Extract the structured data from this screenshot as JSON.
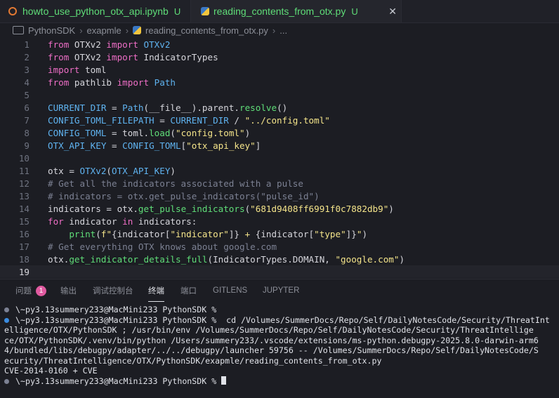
{
  "tabs": [
    {
      "label": "howto_use_python_otx_api.ipynb",
      "status": "U",
      "icon": "jupyter-icon"
    },
    {
      "label": "reading_contents_from_otx.py",
      "status": "U",
      "icon": "python-icon"
    }
  ],
  "breadcrumb": [
    "PythonSDK",
    "exapmle",
    "reading_contents_from_otx.py",
    "..."
  ],
  "editor": {
    "lines": [
      {
        "n": "1"
      },
      {
        "n": "2"
      },
      {
        "n": "3"
      },
      {
        "n": "4"
      },
      {
        "n": "5"
      },
      {
        "n": "6"
      },
      {
        "n": "7"
      },
      {
        "n": "8"
      },
      {
        "n": "9"
      },
      {
        "n": "10"
      },
      {
        "n": "11"
      },
      {
        "n": "12"
      },
      {
        "n": "13"
      },
      {
        "n": "14"
      },
      {
        "n": "15"
      },
      {
        "n": "16"
      },
      {
        "n": "17"
      },
      {
        "n": "18"
      },
      {
        "n": "19"
      }
    ],
    "code": {
      "l1": [
        "from",
        " OTXv2 ",
        "import",
        " OTXv2"
      ],
      "l2": [
        "from",
        " OTXv2 ",
        "import",
        " IndicatorTypes"
      ],
      "l3": [
        "import",
        " toml"
      ],
      "l4": [
        "from",
        " pathlib ",
        "import",
        " Path"
      ],
      "l6": [
        "CURRENT_DIR",
        " = ",
        "Path",
        "(__file__).parent.",
        "resolve",
        "()"
      ],
      "l7": [
        "CONFIG_TOML_FILEPATH",
        " = ",
        "CURRENT_DIR",
        " / ",
        "\"../config.toml\""
      ],
      "l8": [
        "CONFIG_TOML",
        " = toml.",
        "load",
        "(",
        "\"config.toml\"",
        ")"
      ],
      "l9": [
        "OTX_API_KEY",
        " = ",
        "CONFIG_TOML",
        "[",
        "\"otx_api_key\"",
        "]"
      ],
      "l11": [
        "otx = ",
        "OTXv2",
        "(",
        "OTX_API_KEY",
        ")"
      ],
      "l12": "# Get all the indicators associated with a pulse",
      "l13": "# indicators = otx.get_pulse_indicators(\"pulse_id\")",
      "l14": [
        "indicators = otx.",
        "get_pulse_indicators",
        "(",
        "\"681d9408ff6991f0c7882db9\"",
        ")"
      ],
      "l15": [
        "for",
        " indicator ",
        "in",
        " indicators:"
      ],
      "l16": [
        "    ",
        "print",
        "(",
        "f\"",
        "{indicator[",
        "\"indicator\"",
        "]}",
        " + ",
        "{indicator[",
        "\"type\"",
        "]}",
        "\"",
        ")"
      ],
      "l17": "# Get everything OTX knows about google.com",
      "l18": [
        "otx.",
        "get_indicator_details_full",
        "(IndicatorTypes.DOMAIN, ",
        "\"google.com\"",
        ")"
      ]
    }
  },
  "panel": {
    "tabs": [
      "问题",
      "输出",
      "调试控制台",
      "终端",
      "端口",
      "GITLENS",
      "JUPYTER"
    ],
    "problems_count": "1",
    "active_tab": "终端"
  },
  "terminal": {
    "lines": [
      "\\~py3.13summery233@MacMini233 PythonSDK %",
      "\\~py3.13summery233@MacMini233 PythonSDK %  cd /Volumes/SummerDocs/Repo/Self/DailyNotesCode/Security/ThreatInt",
      "elligence/OTX/PythonSDK ; /usr/bin/env /Volumes/SummerDocs/Repo/Self/DailyNotesCode/Security/ThreatIntellige",
      "ce/OTX/PythonSDK/.venv/bin/python /Users/summery233/.vscode/extensions/ms-python.debugpy-2025.8.0-darwin-arm6",
      "4/bundled/libs/debugpy/adapter/../../debugpy/launcher 59756 -- /Volumes/SummerDocs/Repo/Self/DailyNotesCode/S",
      "ecurity/ThreatIntelligence/OTX/PythonSDK/exapmle/reading_contents_from_otx.py",
      "CVE-2014-0160 + CVE",
      "\\~py3.13summery233@MacMini233 PythonSDK % "
    ]
  },
  "colors": {
    "keyword": "#ee6ec6",
    "class": "#5fb3f0",
    "function": "#5fdd78",
    "string": "#f4e48a",
    "comment": "#7c8193"
  }
}
